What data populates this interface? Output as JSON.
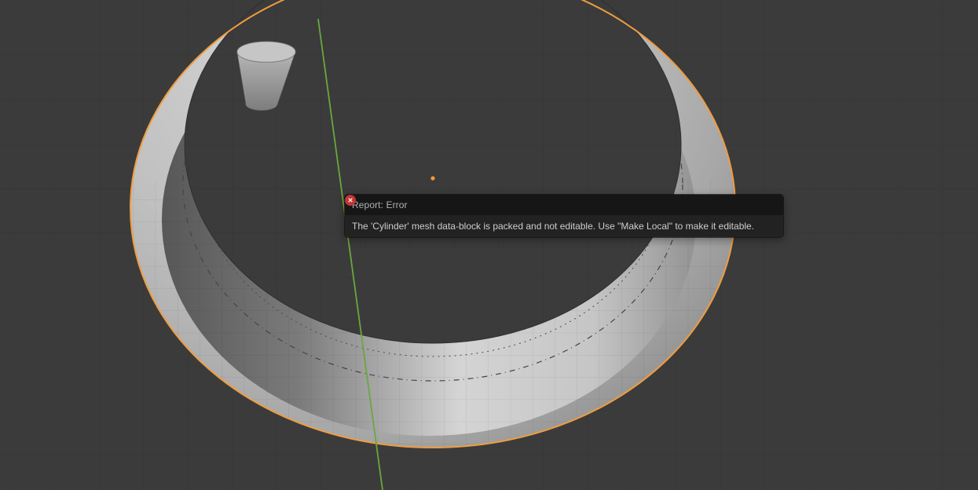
{
  "scene": {
    "background_color": "#3b3b3b",
    "grid_color": "#343434",
    "selection_outline_color": "#ef9d3f",
    "axis_y_color": "#68a83d",
    "origin_dot_color": "#f59a33",
    "objects": [
      {
        "name": "torus-ring",
        "selected": true
      },
      {
        "name": "cylinder",
        "selected": false
      }
    ]
  },
  "report_popup": {
    "title": "Report: Error",
    "icon": "error-circle-x-icon",
    "icon_color": "#c23434",
    "icon_glyph": "✕",
    "message": "The 'Cylinder' mesh data-block is packed and not editable. Use \"Make Local\" to make it editable."
  }
}
